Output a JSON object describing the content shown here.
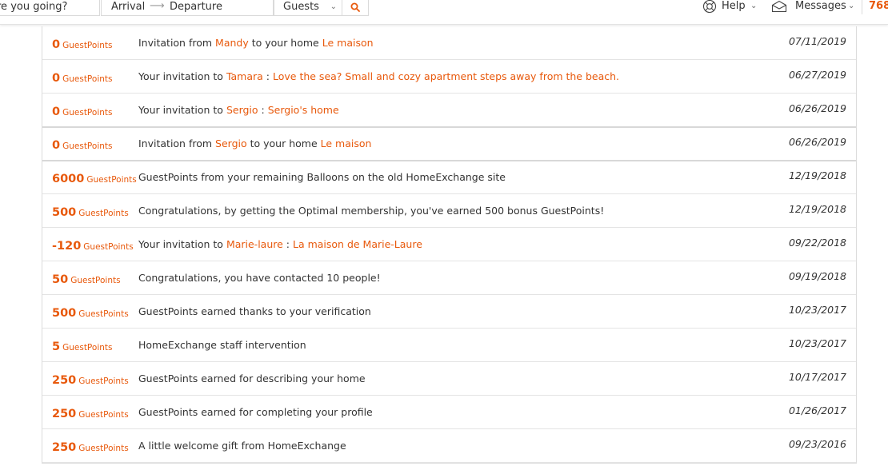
{
  "header": {
    "search_placeholder": "re you going?",
    "arrival": "Arrival",
    "departure": "Departure",
    "guests": "Guests",
    "help": "Help",
    "messages": "Messages",
    "points_balance": "768"
  },
  "unit": "GuestPoints",
  "colors": {
    "accent": "#e8590c",
    "text": "#333333"
  },
  "rows": [
    {
      "points": "0",
      "date": "07/11/2019",
      "parts": [
        {
          "t": "Invitation from "
        },
        {
          "t": "Mandy",
          "hl": true
        },
        {
          "t": " to your home "
        },
        {
          "t": "Le maison",
          "hl": true
        }
      ]
    },
    {
      "points": "0",
      "date": "06/27/2019",
      "parts": [
        {
          "t": "Your invitation to "
        },
        {
          "t": "Tamara",
          "hl": true
        },
        {
          "t": " : "
        },
        {
          "t": "Love the sea? Small and cozy apartment steps away from the beach.",
          "hl": true
        }
      ]
    },
    {
      "points": "0",
      "date": "06/26/2019",
      "parts": [
        {
          "t": "Your invitation to "
        },
        {
          "t": "Sergio",
          "hl": true
        },
        {
          "t": " : "
        },
        {
          "t": "Sergio's home",
          "hl": true
        }
      ]
    },
    {
      "points": "0",
      "date": "06/26/2019",
      "parts": [
        {
          "t": "Invitation from "
        },
        {
          "t": "Sergio",
          "hl": true
        },
        {
          "t": " to your home "
        },
        {
          "t": "Le maison",
          "hl": true
        }
      ]
    },
    {
      "points": "6000",
      "date": "12/19/2018",
      "parts": [
        {
          "t": "GuestPoints from your remaining Balloons on the old HomeExchange site"
        }
      ]
    },
    {
      "points": "500",
      "date": "12/19/2018",
      "parts": [
        {
          "t": "Congratulations, by getting the Optimal membership, you've earned 500 bonus GuestPoints!"
        }
      ]
    },
    {
      "points": "-120",
      "date": "09/22/2018",
      "parts": [
        {
          "t": "Your invitation to "
        },
        {
          "t": "Marie-laure",
          "hl": true
        },
        {
          "t": " : "
        },
        {
          "t": "La maison de Marie-Laure",
          "hl": true
        }
      ]
    },
    {
      "points": "50",
      "date": "09/19/2018",
      "parts": [
        {
          "t": "Congratulations, you have contacted 10 people!"
        }
      ]
    },
    {
      "points": "500",
      "date": "10/23/2017",
      "parts": [
        {
          "t": "GuestPoints earned thanks to your verification"
        }
      ]
    },
    {
      "points": "5",
      "date": "10/23/2017",
      "parts": [
        {
          "t": "HomeExchange staff intervention"
        }
      ]
    },
    {
      "points": "250",
      "date": "10/17/2017",
      "parts": [
        {
          "t": "GuestPoints earned for describing your home"
        }
      ]
    },
    {
      "points": "250",
      "date": "01/26/2017",
      "parts": [
        {
          "t": "GuestPoints earned for completing your profile"
        }
      ]
    },
    {
      "points": "250",
      "date": "09/23/2016",
      "parts": [
        {
          "t": "A little welcome gift from HomeExchange"
        }
      ]
    }
  ]
}
